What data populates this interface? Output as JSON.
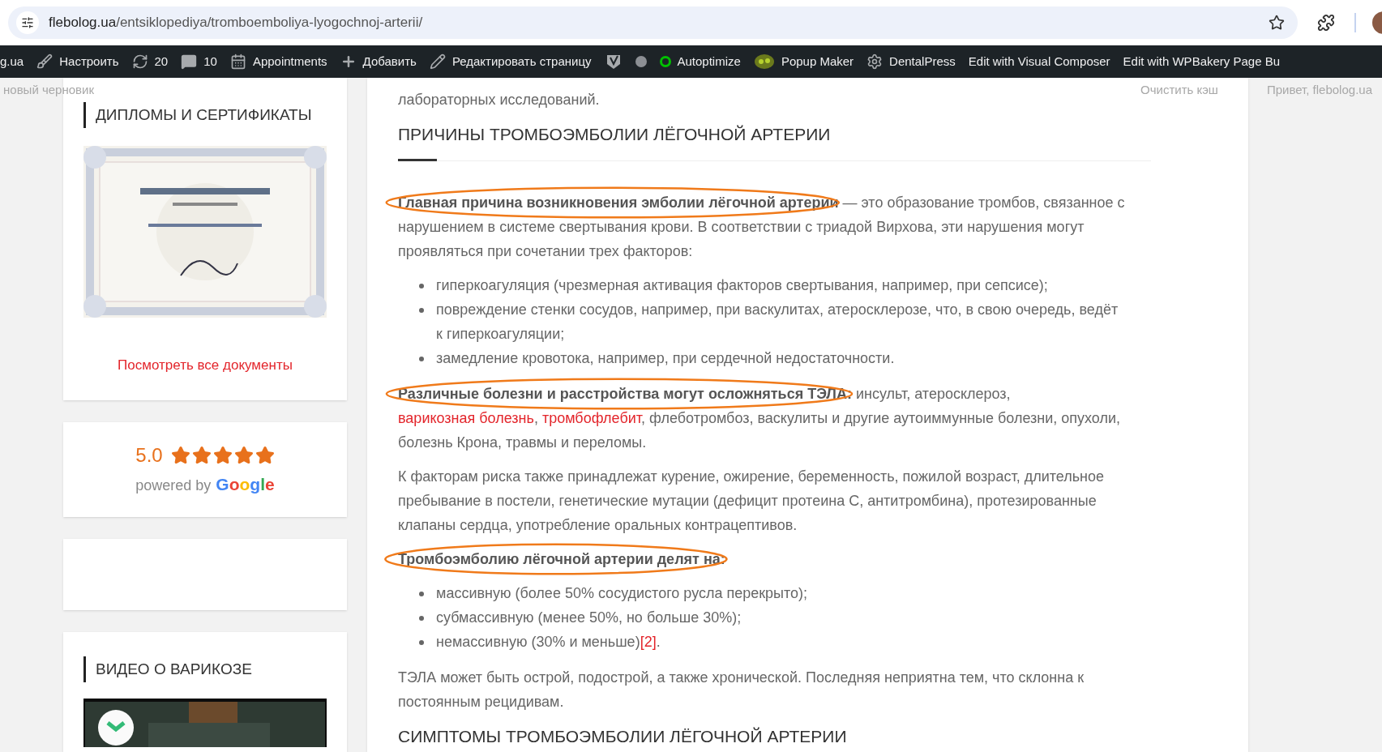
{
  "browser": {
    "url_domain": "flebolog.ua",
    "url_path": "/entsiklopediya/tromboemboliya-lyogochnoj-arterii/"
  },
  "admin_bar": [
    {
      "kind": "plain",
      "label": "g.ua"
    },
    {
      "kind": "brush",
      "label": "Настроить"
    },
    {
      "kind": "refresh",
      "label": "20"
    },
    {
      "kind": "comment",
      "label": "10"
    },
    {
      "kind": "calendar",
      "label": "Appointments"
    },
    {
      "kind": "plus",
      "label": "Добавить"
    },
    {
      "kind": "pencil",
      "label": "Редактировать страницу"
    },
    {
      "kind": "shield"
    },
    {
      "kind": "dot"
    },
    {
      "kind": "ring",
      "label": "Autoptimize"
    },
    {
      "kind": "popup",
      "label": "Popup Maker"
    },
    {
      "kind": "gear",
      "label": "DentalPress"
    },
    {
      "kind": "plain",
      "label": "Edit with Visual Composer"
    },
    {
      "kind": "plain",
      "label": "Edit with WPBakery Page Bu"
    }
  ],
  "faded_menu": {
    "left": "новый черновик",
    "right": [
      "Очистить кэш",
      "Привет, flebolog.ua"
    ]
  },
  "sidebar": {
    "diplomas": {
      "title": "ДИПЛОМЫ И СЕРТИФИКАТЫ",
      "link": "Посмотреть все документы"
    },
    "rating": {
      "score": "5.0",
      "stars": 5,
      "powered_by": "powered by",
      "brand": "Google"
    },
    "video": {
      "title": "ВИДЕО О ВАРИКОЗЕ"
    }
  },
  "article": {
    "blocks": [
      {
        "kind": "paragraph",
        "circled": false,
        "segments": [
          {
            "kind": "text",
            "text": "лабораторных исследований."
          }
        ]
      },
      {
        "kind": "heading",
        "text": "ПРИЧИНЫ ТРОМБОЭМБОЛИИ ЛЁГОЧНОЙ АРТЕРИИ"
      },
      {
        "kind": "paragraph",
        "circled": true,
        "segments": [
          {
            "kind": "bold",
            "text": "Главная причина возникновения эмболии лёгочной артерии"
          },
          {
            "kind": "text",
            "text": " — это образование тромбов, связанное с нарушением в системе свертывания крови. В соответствии с триадой Вирхова, эти нарушения могут проявляться при сочетании трех факторов:"
          }
        ]
      },
      {
        "kind": "list",
        "items": [
          [
            {
              "kind": "text",
              "text": "гиперкоагуляция (чрезмерная активация факторов свертывания, например, при сепсисе);"
            }
          ],
          [
            {
              "kind": "text",
              "text": "повреждение стенки сосудов, например, при васкулитах, атеросклерозе, что, в свою очередь, ведёт к гиперкоагуляции;"
            }
          ],
          [
            {
              "kind": "text",
              "text": "замедление кровотока, например, при сердечной недостаточности."
            }
          ]
        ]
      },
      {
        "kind": "paragraph",
        "circled": true,
        "segments": [
          {
            "kind": "bold",
            "text": "Различные болезни и расстройства могут осложняться ТЭЛА:"
          },
          {
            "kind": "text",
            "text": " инсульт, атеросклероз, "
          },
          {
            "kind": "link",
            "text": "варикозная болезнь"
          },
          {
            "kind": "text",
            "text": ", "
          },
          {
            "kind": "link",
            "text": "тромбофлебит"
          },
          {
            "kind": "text",
            "text": ", флеботромбоз, васкулиты и другие аутоиммунные болезни, опухоли, болезнь Крона, травмы и переломы."
          }
        ]
      },
      {
        "kind": "paragraph",
        "circled": false,
        "segments": [
          {
            "kind": "text",
            "text": "К факторам риска также принадлежат курение, ожирение, беременность, пожилой возраст, длительное пребывание в постели, генетические мутации (дефицит протеина С, антитромбина), протезированные клапаны сердца, употребление оральных контрацептивов."
          }
        ]
      },
      {
        "kind": "paragraph",
        "circled": true,
        "segments": [
          {
            "kind": "bold",
            "text": "Тромбоэмболию лёгочной артерии делят на:"
          }
        ]
      },
      {
        "kind": "list",
        "items": [
          [
            {
              "kind": "text",
              "text": "массивную (более 50% сосудистого русла перекрыто);"
            }
          ],
          [
            {
              "kind": "text",
              "text": "субмассивную (менее 50%, но больше 30%);"
            }
          ],
          [
            {
              "kind": "text",
              "text": "немассивную (30% и меньше)"
            },
            {
              "kind": "link",
              "text": "[2]"
            },
            {
              "kind": "text",
              "text": "."
            }
          ]
        ]
      },
      {
        "kind": "paragraph",
        "circled": false,
        "segments": [
          {
            "kind": "text",
            "text": "ТЭЛА может быть острой, подострой, а также хронической. Последняя неприятна тем, что склонна к постоянным рецидивам."
          }
        ]
      },
      {
        "kind": "heading2",
        "text": "СИМПТОМЫ ТРОМБОЭМБОЛИИ ЛЁГОЧНОЙ АРТЕРИИ"
      }
    ]
  }
}
